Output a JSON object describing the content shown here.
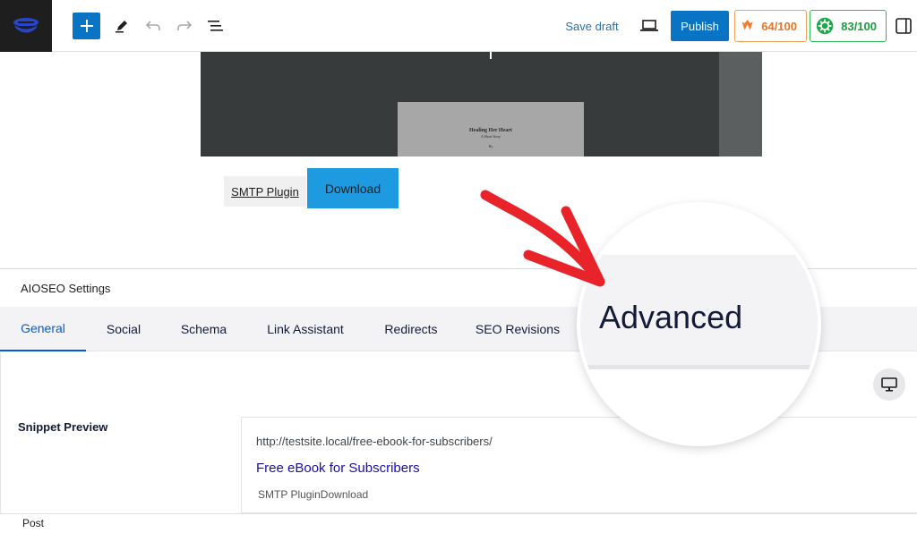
{
  "toolbar": {
    "save_draft": "Save draft",
    "publish": "Publish",
    "score_monsterinsights": "64/100",
    "score_seo": "83/100"
  },
  "canvas": {
    "book_title": "Healing Her Heart",
    "book_subtitle": "A Short Story",
    "book_author": "By",
    "smtp_link": "SMTP Plugin",
    "download_button": "Download"
  },
  "aioseo": {
    "title": "AIOSEO Settings",
    "tabs": [
      "General",
      "Social",
      "Schema",
      "Link Assistant",
      "Redirects",
      "SEO Revisions"
    ],
    "active_tab": "General",
    "snippet_label": "Snippet Preview",
    "snippet": {
      "url": "http://testsite.local/free-ebook-for-subscribers/",
      "title": "Free eBook for Subscribers",
      "description": "SMTP PluginDownload"
    }
  },
  "magnifier": {
    "label": "Advanced"
  },
  "footer": {
    "breadcrumb": "Post"
  },
  "colors": {
    "accent": "#0a74c4",
    "aioseo_active": "#005ae0",
    "arrow": "#e8232a",
    "score_orange": "#e8752a",
    "score_green": "#1a9e3d"
  },
  "icons": [
    "wordpress-logo-icon",
    "plus-icon",
    "pencil-icon",
    "undo-icon",
    "redo-icon",
    "list-view-icon",
    "laptop-icon",
    "monsterinsights-icon",
    "aioseo-gear-icon",
    "sidebar-toggle-icon",
    "desktop-monitor-icon"
  ]
}
